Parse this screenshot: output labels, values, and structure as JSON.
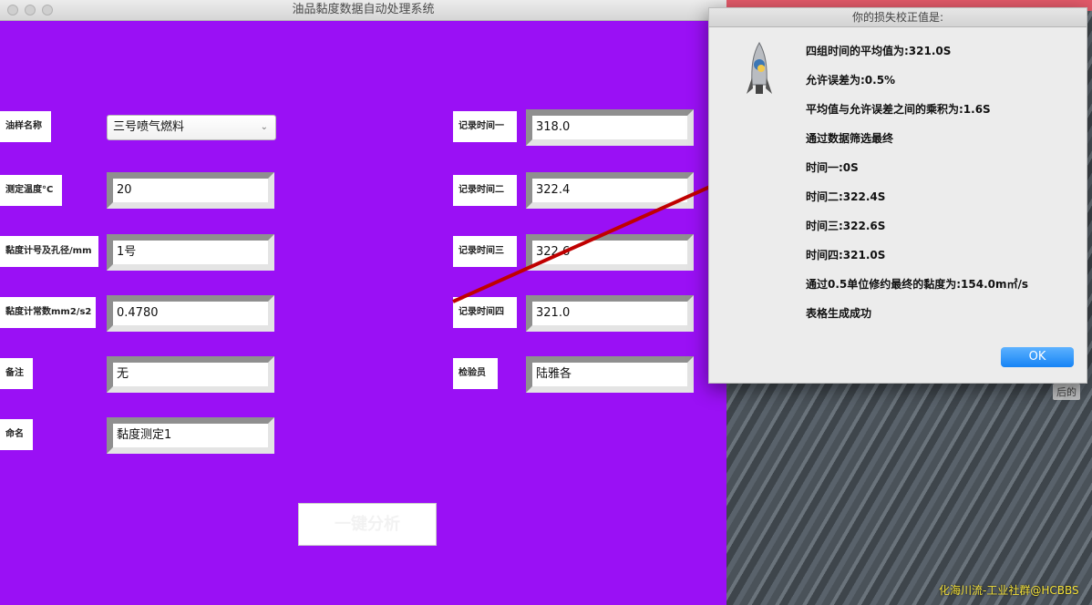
{
  "window": {
    "title": "油品黏度数据自动处理系统"
  },
  "form": {
    "sample_name_label": "油样名称",
    "sample_name_value": "三号喷气燃料",
    "temp_label": "测定温度°C",
    "temp_value": "20",
    "viscometer_label": "黏度计号及孔径/mm",
    "viscometer_value": "1号",
    "constant_label": "黏度计常数mm2/s2",
    "constant_value": "0.4780",
    "remark_label": "备注",
    "remark_value": "无",
    "name_label": "命名",
    "name_value": "黏度测定1",
    "time1_label": "记录时间一",
    "time1_value": "318.0",
    "time2_label": "记录时间二",
    "time2_value": "322.4",
    "time3_label": "记录时间三",
    "time3_value": "322.6",
    "time4_label": "记录时间四",
    "time4_value": "321.0",
    "inspector_label": "检验员",
    "inspector_value": "陆雅各",
    "analyze_label": "一键分析"
  },
  "dialog": {
    "title": "你的损失校正值是:",
    "lines": [
      "四组时间的平均值为:321.0S",
      "允许误差为:0.5%",
      "平均值与允许误差之间的乘积为:1.6S",
      "通过数据筛选最终",
      "时间一:0S",
      "时间二:322.4S",
      "时间三:322.6S",
      "时间四:321.0S",
      "通过0.5单位修约最终的黏度为:154.0m㎡/s",
      "表格生成成功"
    ],
    "ok_label": "OK"
  },
  "desktop": {
    "badge": "后的",
    "watermark": "化海川流-工业社群@HCBBS"
  },
  "colors": {
    "window_bg": "#9a10f5",
    "ok_button": "#1583f5",
    "arrow": "#c00000"
  }
}
